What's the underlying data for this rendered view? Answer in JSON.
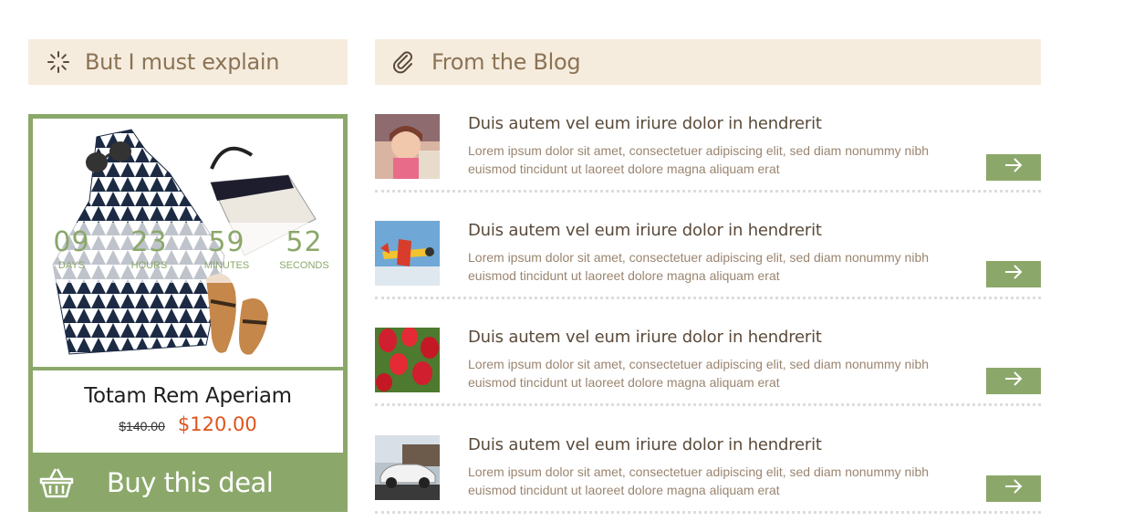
{
  "deal": {
    "header_title": "But I must explain",
    "header_icon": "spinner-icon",
    "product_name": "Totam Rem Aperiam",
    "old_price": "$140.00",
    "new_price": "$120.00",
    "buy_label": "Buy this deal",
    "buy_icon": "basket-icon",
    "countdown": [
      {
        "value": "09",
        "label": "DAYS"
      },
      {
        "value": "23",
        "label": "HOURS"
      },
      {
        "value": "59",
        "label": "MINUTES"
      },
      {
        "value": "52",
        "label": "SECONDS"
      }
    ],
    "image": "product-photo-dress-bag-sunglasses-sandals"
  },
  "blog": {
    "header_title": "From the Blog",
    "header_icon": "paperclip-icon",
    "posts": [
      {
        "title": "Duis autem vel eum iriure dolor in hendrerit",
        "excerpt": "Lorem ipsum dolor sit amet, consectetuer adipiscing elit, sed diam nonummy nibh euismod tincidunt ut laoreet dolore magna aliquam erat",
        "thumb": "girl-photo"
      },
      {
        "title": "Duis autem vel eum iriure dolor in hendrerit",
        "excerpt": "Lorem ipsum dolor sit amet, consectetuer adipiscing elit, sed diam nonummy nibh euismod tincidunt ut laoreet dolore magna aliquam erat",
        "thumb": "airplane-photo"
      },
      {
        "title": "Duis autem vel eum iriure dolor in hendrerit",
        "excerpt": "Lorem ipsum dolor sit amet, consectetuer adipiscing elit, sed diam nonummy nibh euismod tincidunt ut laoreet dolore magna aliquam erat",
        "thumb": "tulips-photo"
      },
      {
        "title": "Duis autem vel eum iriure dolor in hendrerit",
        "excerpt": "Lorem ipsum dolor sit amet, consectetuer adipiscing elit, sed diam nonummy nibh euismod tincidunt ut laoreet dolore magna aliquam erat",
        "thumb": "car-photo"
      }
    ],
    "read_more_icon": "arrow-right-icon"
  },
  "colors": {
    "accent_green": "#8ba86a",
    "header_bg": "#f6ecdd",
    "header_text": "#8b7355",
    "sale_price": "#e0531b"
  }
}
